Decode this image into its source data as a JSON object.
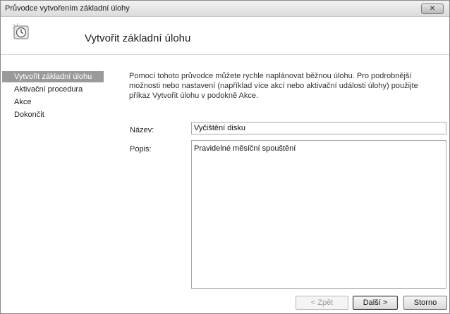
{
  "window": {
    "title": "Průvodce vytvořením základní úlohy",
    "close_label": "✕"
  },
  "header": {
    "title": "Vytvořit základní úlohu",
    "icon": "task-clock-icon"
  },
  "steps": [
    {
      "label": "Vytvořit základní úlohu",
      "active": true
    },
    {
      "label": "Aktivační procedura",
      "active": false
    },
    {
      "label": "Akce",
      "active": false
    },
    {
      "label": "Dokončit",
      "active": false
    }
  ],
  "main": {
    "description": "Pomocí tohoto průvodce můžete rychle naplánovat běžnou úlohu. Pro podrobnější možnosti nebo nastavení (například více akcí nebo aktivační události úlohy) použijte příkaz Vytvořit úlohu v podokně Akce.",
    "name_label": "Název:",
    "name_value": "Vyčištění disku",
    "desc_label": "Popis:",
    "desc_value": "Pravidelné měsíční spouštění"
  },
  "buttons": {
    "back": "< Zpět",
    "next": "Další >",
    "cancel": "Storno"
  }
}
